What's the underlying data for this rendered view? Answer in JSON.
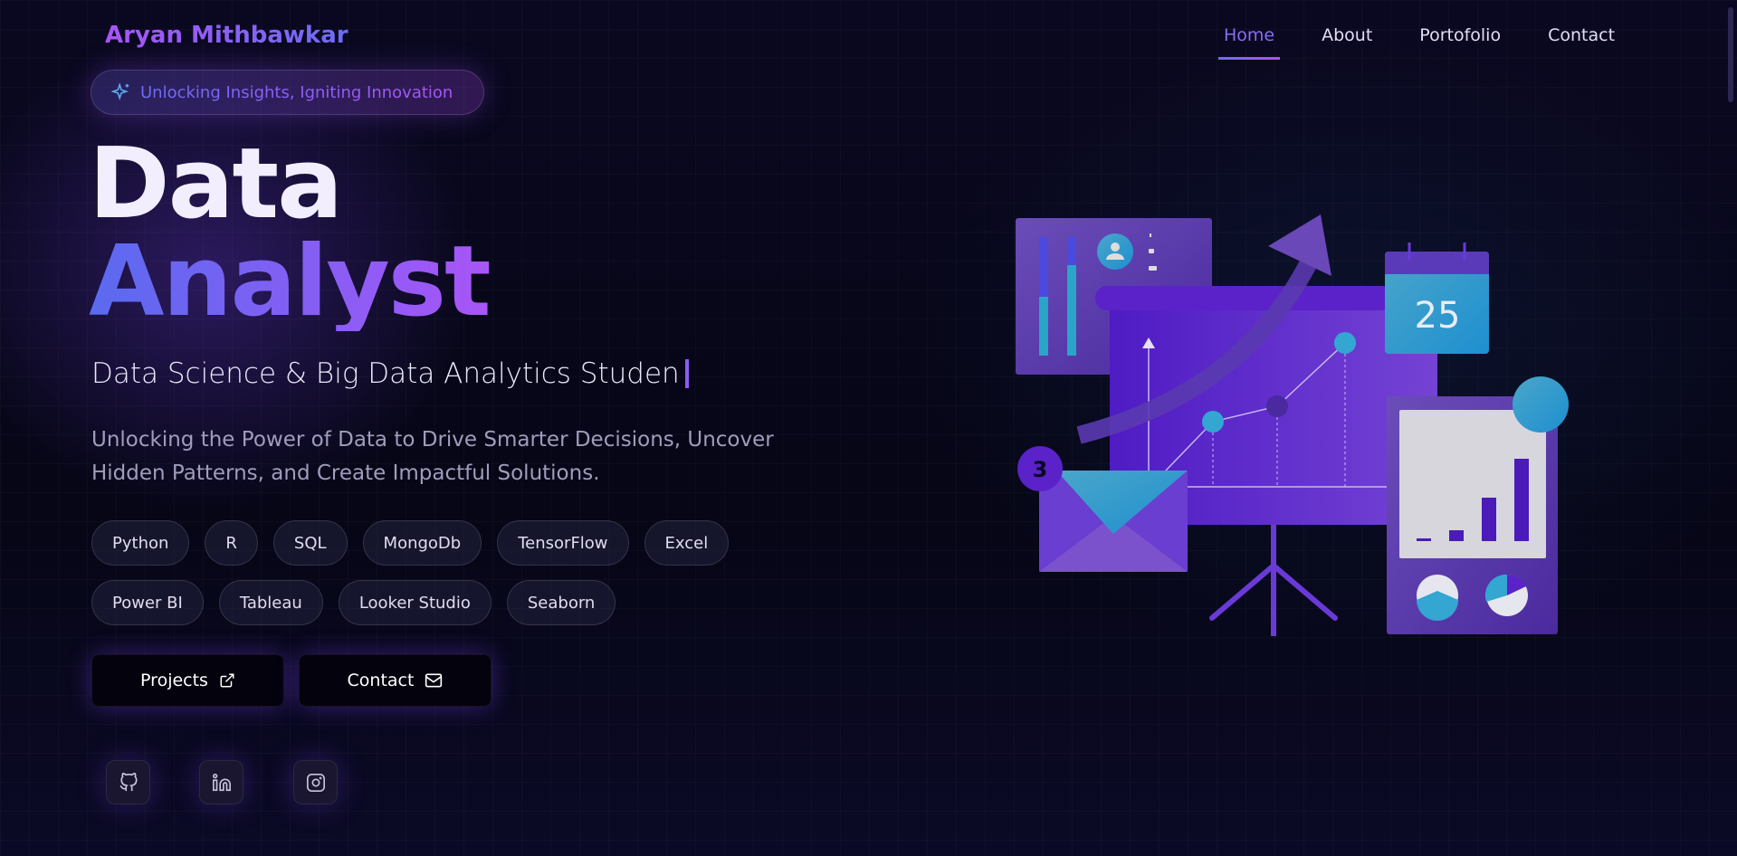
{
  "header": {
    "brand": "Aryan Mithbawkar",
    "nav": [
      {
        "label": "Home",
        "active": true
      },
      {
        "label": "About"
      },
      {
        "label": "Portofolio"
      },
      {
        "label": "Contact"
      }
    ]
  },
  "hero": {
    "tagline": "Unlocking Insights, Igniting Innovation",
    "title_line1": "Data",
    "title_line2": "Analyst",
    "subtitle": "Data Science & Big Data Analytics Studen",
    "description": "Unlocking the Power of Data to Drive Smarter Decisions, Uncover Hidden Patterns, and Create Impactful Solutions.",
    "skills": [
      "Python",
      "R",
      "SQL",
      "MongoDb",
      "TensorFlow",
      "Excel",
      "Power BI",
      "Tableau",
      "Looker Studio",
      "Seaborn"
    ],
    "buttons": {
      "projects": "Projects",
      "contact": "Contact"
    },
    "socials": [
      "github-icon",
      "linkedin-icon",
      "instagram-icon"
    ]
  },
  "illustration": {
    "calendar_day": "25",
    "notification_count": "3"
  },
  "colors": {
    "accent": "#8b5cf6",
    "accent_blue": "#6d6cf5",
    "background": "#070716"
  }
}
